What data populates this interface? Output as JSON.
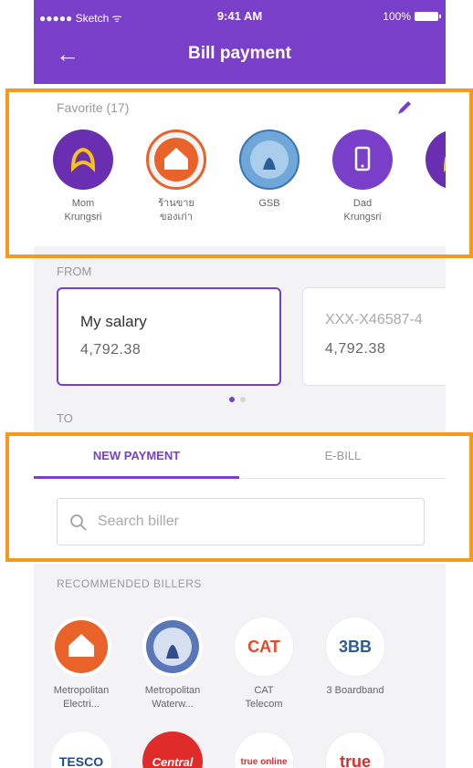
{
  "status": {
    "carrier": "●●●●● Sketch ᯤ",
    "time": "9:41 AM",
    "battery": "100%"
  },
  "header": {
    "title": "Bill payment"
  },
  "favorite": {
    "label": "Favorite (17)",
    "items": [
      {
        "name1": "Mom",
        "name2": "Krungsri"
      },
      {
        "name1": "ร้านขาย",
        "name2": "ของเก่า"
      },
      {
        "name1": "GSB",
        "name2": ""
      },
      {
        "name1": "Dad",
        "name2": "Krungsri"
      }
    ]
  },
  "from": {
    "label": "FROM",
    "accounts": [
      {
        "name": "My salary",
        "balance": "4,792.38"
      },
      {
        "name": "XXX-X46587-4",
        "balance": "4,792.38"
      }
    ]
  },
  "to": {
    "label": "TO"
  },
  "tabs": {
    "new_payment": "NEW PAYMENT",
    "ebill": "E-BILL"
  },
  "search": {
    "placeholder": "Search biller"
  },
  "recommended": {
    "label": "RECOMMENDED BILLERS",
    "billers": [
      {
        "name1": "Metropolitan",
        "name2": "Electri..."
      },
      {
        "name1": "Metropolitan",
        "name2": "Waterw..."
      },
      {
        "name1": "CAT",
        "name2": "Telecom",
        "logo": "CAT"
      },
      {
        "name1": "3 Boardband",
        "name2": "",
        "logo": "3BB"
      },
      {
        "name1": "",
        "name2": "",
        "logo": "TESCO"
      },
      {
        "name1": "",
        "name2": "",
        "logo": "Central"
      },
      {
        "name1": "",
        "name2": "",
        "logo": "true online"
      },
      {
        "name1": "",
        "name2": "",
        "logo": "true"
      }
    ]
  },
  "colors": {
    "brand": "#7a3fc8",
    "highlight": "#f59a1d"
  }
}
